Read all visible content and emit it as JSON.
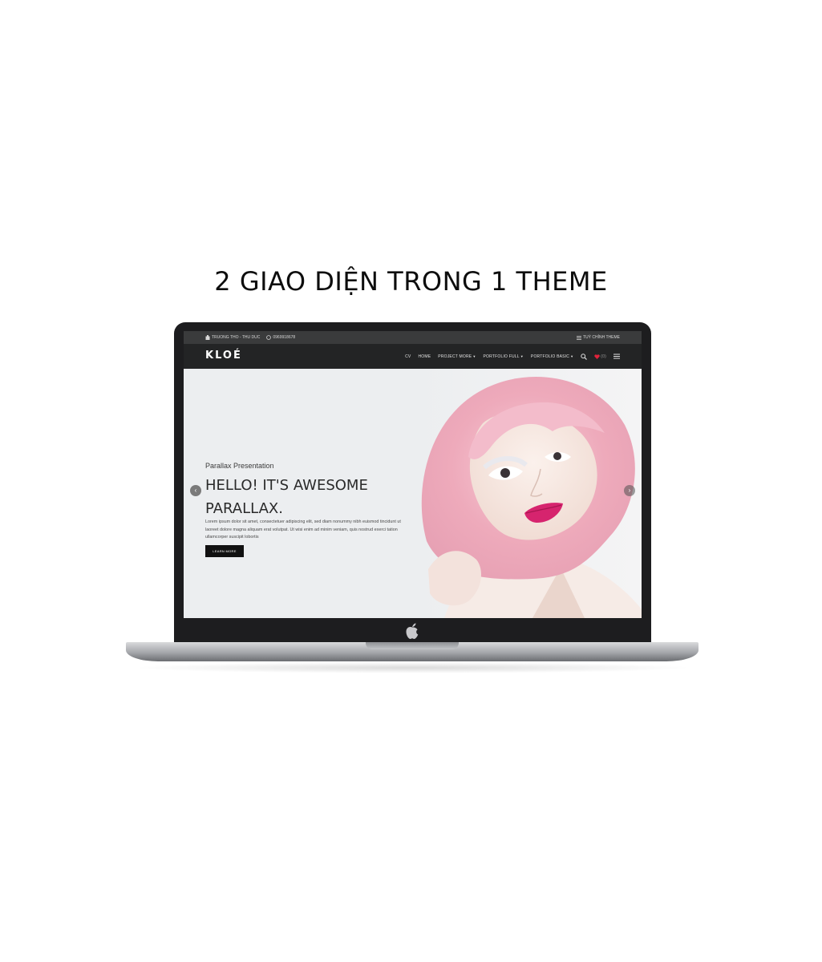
{
  "headline": "2 GIAO DIỆN TRONG 1 THEME",
  "site": {
    "topbar": {
      "address": "TRUONG THO - THU DUC",
      "phone": "0969918678",
      "customize": "TUỲ CHỈNH THEME"
    },
    "logo": "KLOÉ",
    "menu": [
      {
        "label": "CV"
      },
      {
        "label": "HOME"
      },
      {
        "label": "PROJECT MORE"
      },
      {
        "label": "PORTFOLIO FULL"
      },
      {
        "label": "PORTFOLIO BASIC"
      }
    ],
    "wishlist_count": "(0)",
    "hero": {
      "subtitle": "Parallax Presentation",
      "title": "HELLO! IT'S AWESOME PARALLAX.",
      "body": "Lorem ipsum dolor sit amet, consectetuer adipiscing elit, sed diam nonummy nibh euismod tincidunt ut laoreet dolore magna aliquam erat volutpat. Ut wisi enim ad minim veniam, quis nostrud exerci tation ullamcorper suscipit lobortis",
      "button": "LEARN MORE"
    }
  },
  "colors": {
    "accent_heart": "#e0233b",
    "lipstick": "#d6246e",
    "hair": "#f0b6c4"
  }
}
